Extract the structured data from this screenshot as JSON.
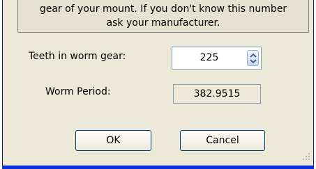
{
  "info": {
    "line1": "gear of your mount. If you don't know this number",
    "line2": "ask your manufacturer."
  },
  "teeth": {
    "label": "Teeth in worm gear:",
    "value": "225"
  },
  "period": {
    "label": "Worm Period:",
    "value": "382.9515"
  },
  "buttons": {
    "ok": "OK",
    "cancel": "Cancel"
  },
  "icons": {
    "spinner": "up-down-arrows-icon",
    "grip": "resize-grip-icon"
  }
}
